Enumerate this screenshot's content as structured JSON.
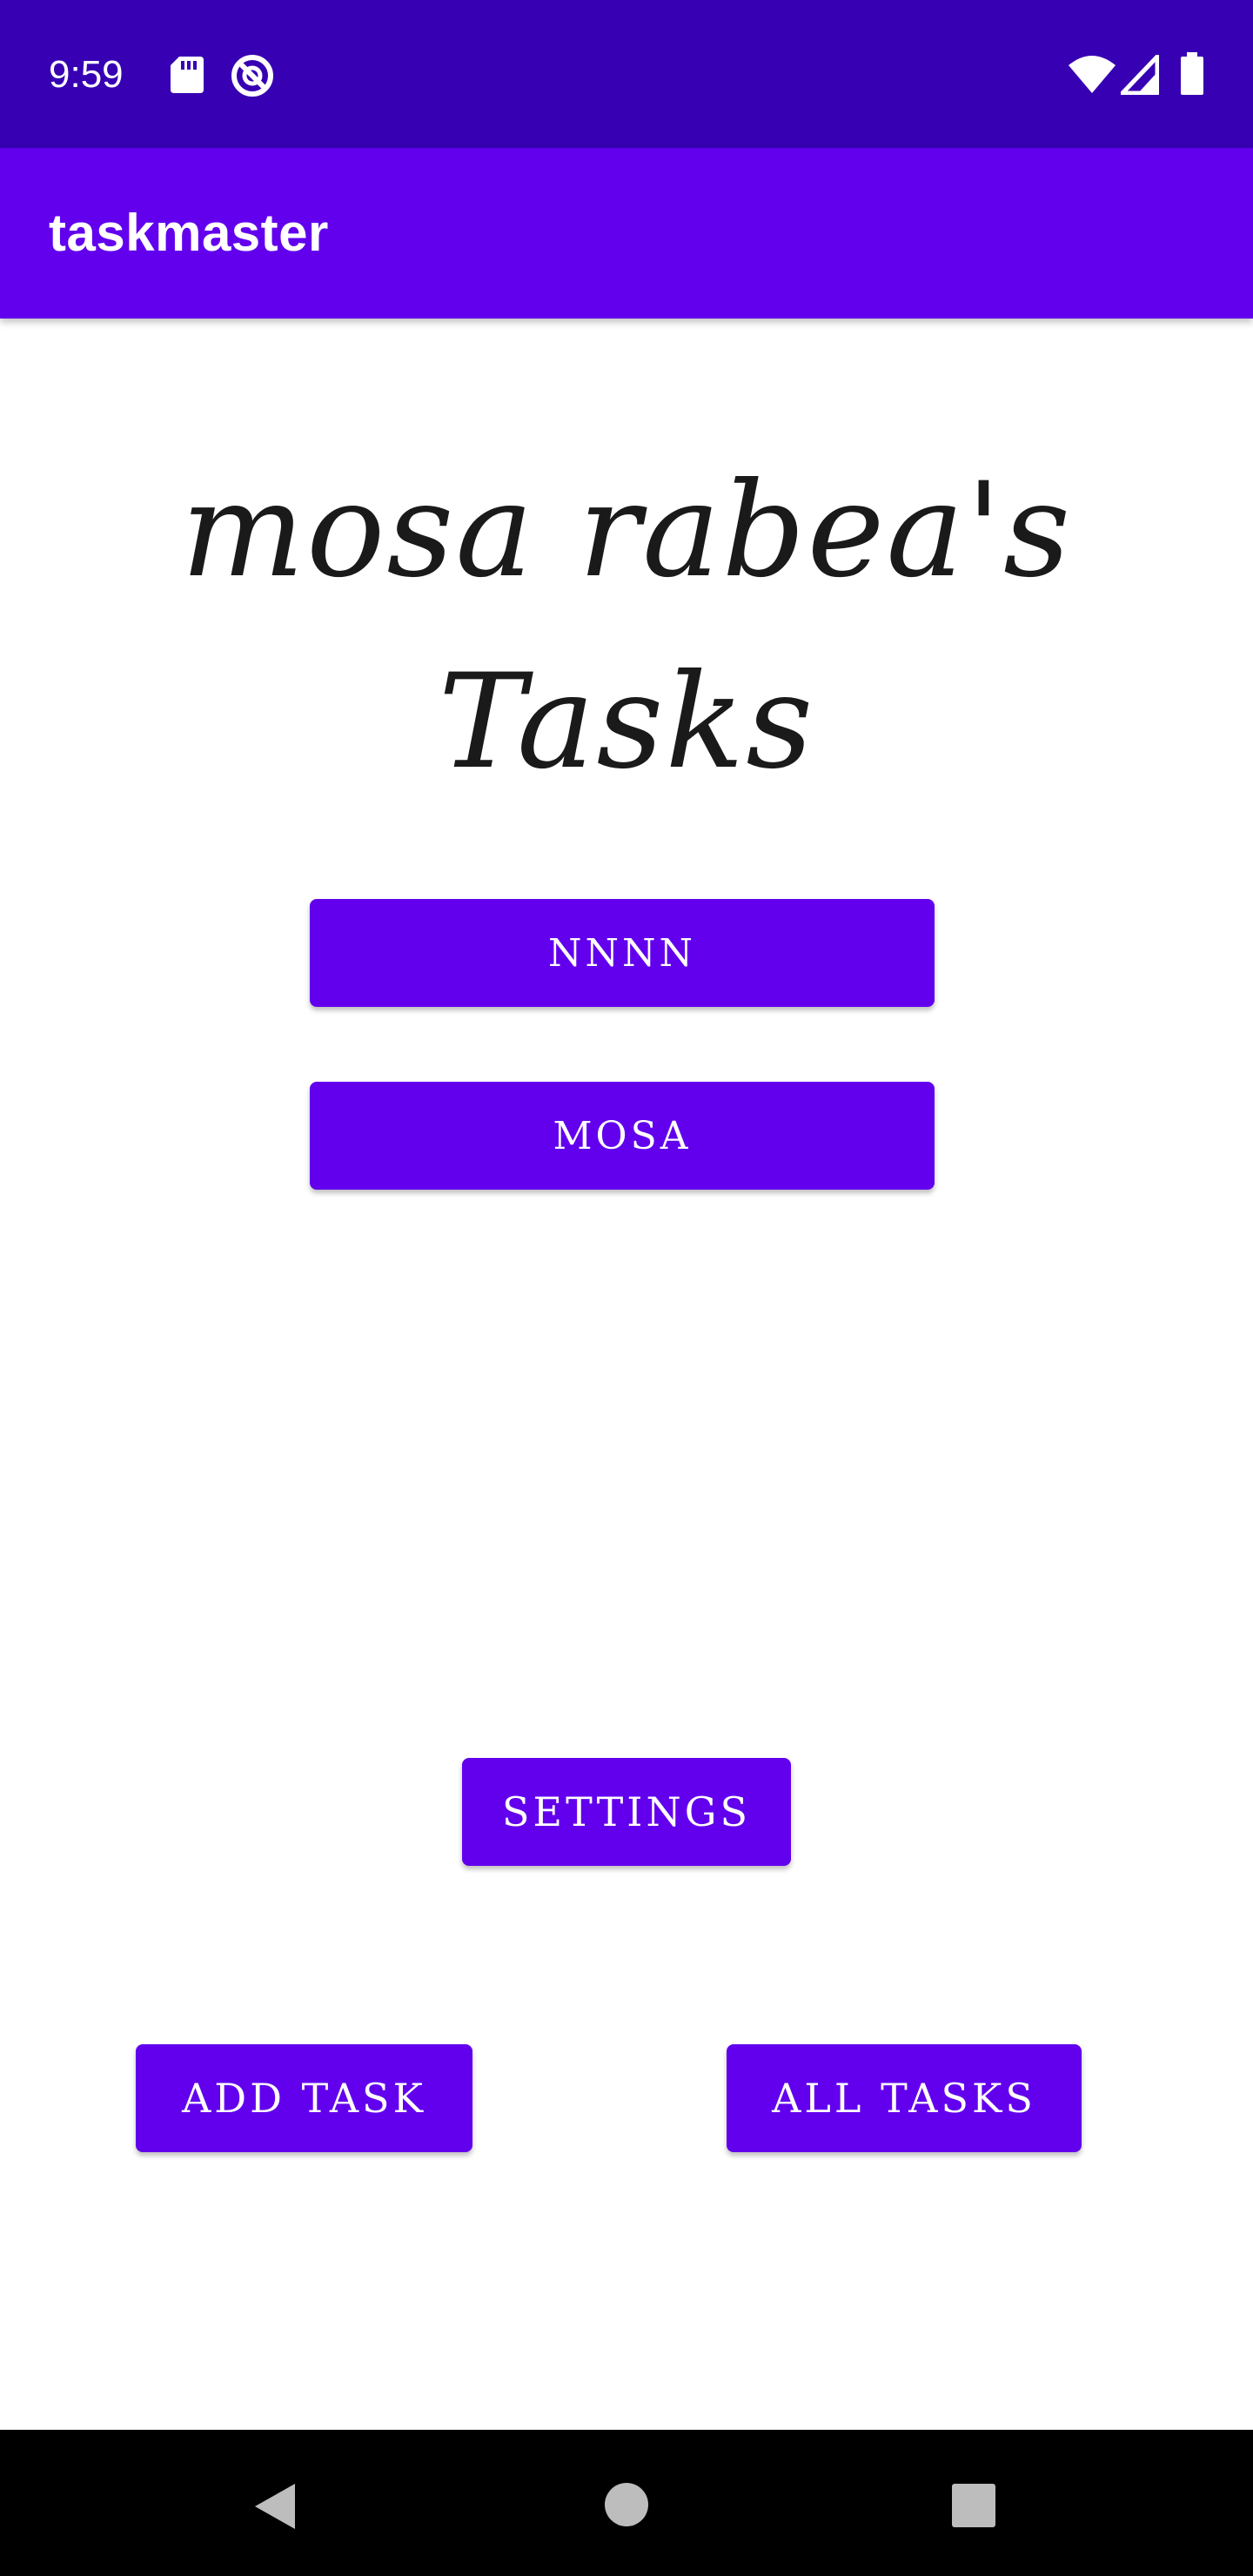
{
  "status_bar": {
    "time": "9:59",
    "icons": [
      "sd-card-icon",
      "do-not-disturb-icon",
      "wifi-icon",
      "cellular-signal-icon",
      "battery-icon"
    ]
  },
  "app_bar": {
    "title": "taskmaster"
  },
  "heading": {
    "text": "mosa rabea's Tasks"
  },
  "task_buttons": [
    {
      "label": "NNNN"
    },
    {
      "label": "MOSA"
    }
  ],
  "settings_button": {
    "label": "SETTINGS"
  },
  "add_task_button": {
    "label": "ADD TASK"
  },
  "all_tasks_button": {
    "label": "ALL TASKS"
  },
  "nav_bar": {
    "icons": [
      "back-icon",
      "home-icon",
      "recents-icon"
    ]
  },
  "colors": {
    "status_bar": "#3700b3",
    "primary": "#6200ee",
    "background": "#ffffff",
    "nav_bar": "#000000"
  }
}
